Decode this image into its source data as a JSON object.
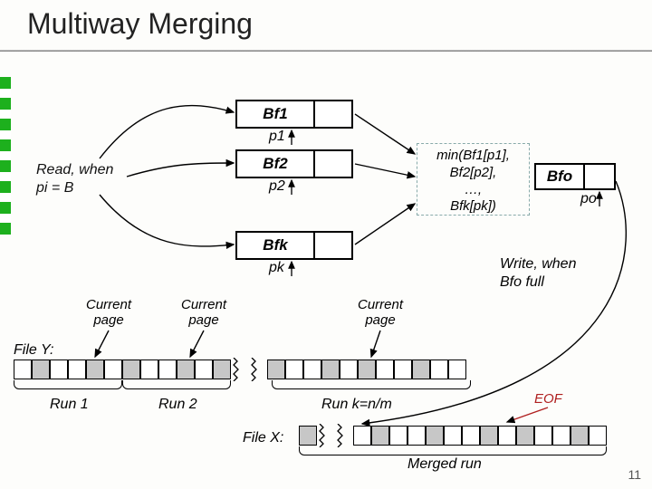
{
  "title": "Multiway Merging",
  "read_label_l1": "Read, when",
  "read_label_l2": "pi = B",
  "buffers": {
    "bf1": "Bf1",
    "bf2": "Bf2",
    "bfk": "Bfk",
    "bfo": "Bfo"
  },
  "pointers": {
    "p1": "p1",
    "p2": "p2",
    "pk": "pk",
    "po": "po"
  },
  "min_l1": "min(Bf1[p1],",
  "min_l2": "Bf2[p2],",
  "min_l3": "…,",
  "min_l4": "Bfk[pk])",
  "write_l1": "Write, when",
  "write_l2": "Bfo full",
  "current_page": "Current\npage",
  "file_y": "File Y:",
  "file_x": "File X:",
  "runs": {
    "r1": "Run 1",
    "r2": "Run 2",
    "rk": "Run k=n/m"
  },
  "eof": "EOF",
  "merged": "Merged run",
  "page_number": "11"
}
